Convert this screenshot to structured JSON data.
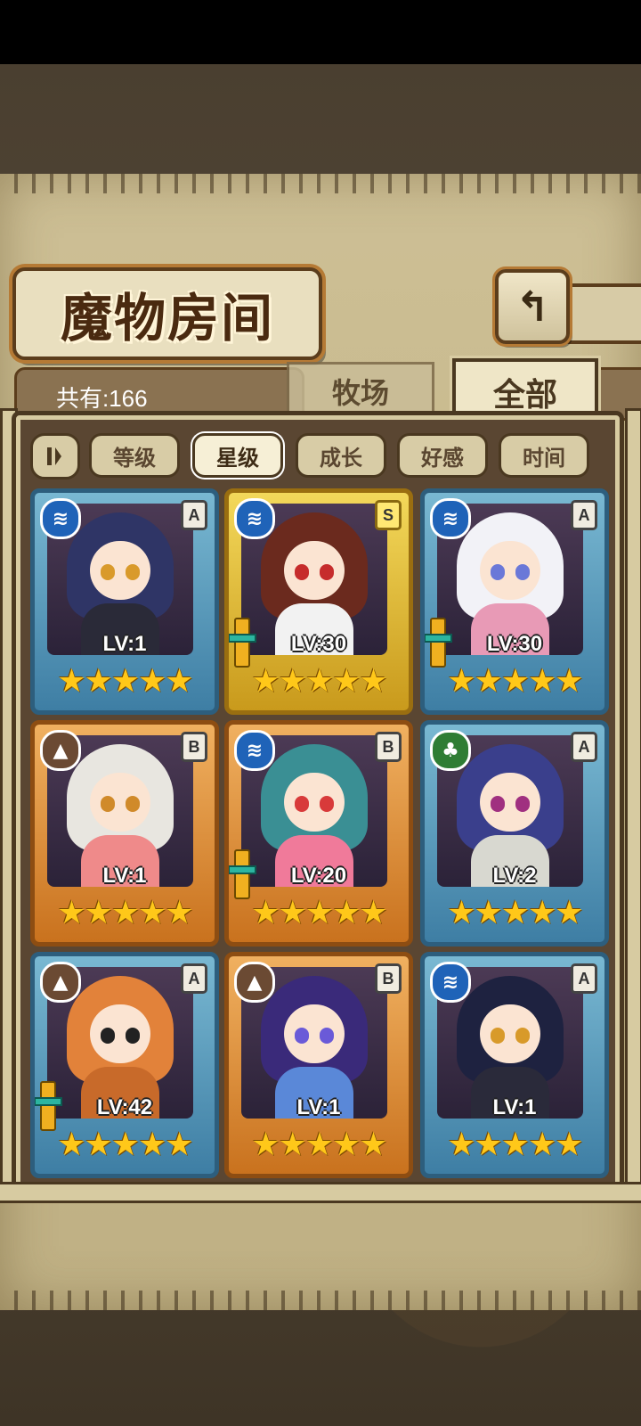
{
  "title": "魔物房间",
  "back_label": "↰",
  "total_count": "共有:166",
  "tabs": {
    "pasture": "牧场",
    "all": "全部"
  },
  "sort": {
    "toggle_icon": "sort-direction-icon",
    "buttons": [
      "等级",
      "星级",
      "成长",
      "好感",
      "时间"
    ],
    "active": "星级"
  },
  "cards": [
    {
      "frame": "blue",
      "element": "water",
      "rank": "A",
      "level": "LV:1",
      "stars": "★★★★★",
      "weapon": false,
      "hair": "#2f3566",
      "eye": "#d99a2b",
      "outfit": "#2a2a38"
    },
    {
      "frame": "gold",
      "element": "water",
      "rank": "S",
      "level": "LV:30",
      "stars": "★★★★★",
      "weapon": true,
      "hair": "#6b2a1e",
      "eye": "#c62c2c",
      "outfit": "#f2f2f2"
    },
    {
      "frame": "blue",
      "element": "water",
      "rank": "A",
      "level": "LV:30",
      "stars": "★★★★★",
      "weapon": true,
      "hair": "#f2f2f7",
      "eye": "#6a78d8",
      "outfit": "#e89ab6"
    },
    {
      "frame": "orange",
      "element": "earth",
      "rank": "B",
      "level": "LV:1",
      "stars": "★★★★★",
      "weapon": false,
      "hair": "#e8e6e0",
      "eye": "#d08a2a",
      "outfit": "#ef8a8a"
    },
    {
      "frame": "orange",
      "element": "water",
      "rank": "B",
      "level": "LV:20",
      "stars": "★★★★★",
      "weapon": true,
      "hair": "#3a8f94",
      "eye": "#d83a3a",
      "outfit": "#f07a9a"
    },
    {
      "frame": "blue",
      "element": "wood",
      "rank": "A",
      "level": "LV:2",
      "stars": "★★★★★",
      "weapon": false,
      "hair": "#3a3f8c",
      "eye": "#a03080",
      "outfit": "#d8d8d0"
    },
    {
      "frame": "blue",
      "element": "earth",
      "rank": "A",
      "level": "LV:42",
      "stars": "★★★★★",
      "weapon": true,
      "hair": "#e2823a",
      "eye": "#222222",
      "outfit": "#c86a2a"
    },
    {
      "frame": "orange",
      "element": "earth",
      "rank": "B",
      "level": "LV:1",
      "stars": "★★★★★",
      "weapon": false,
      "hair": "#3a2a7a",
      "eye": "#6a5ad8",
      "outfit": "#5a88d8"
    },
    {
      "frame": "blue",
      "element": "water",
      "rank": "A",
      "level": "LV:1",
      "stars": "★★★★★",
      "weapon": false,
      "hair": "#1e2240",
      "eye": "#d89a2a",
      "outfit": "#2a2a3a"
    }
  ]
}
